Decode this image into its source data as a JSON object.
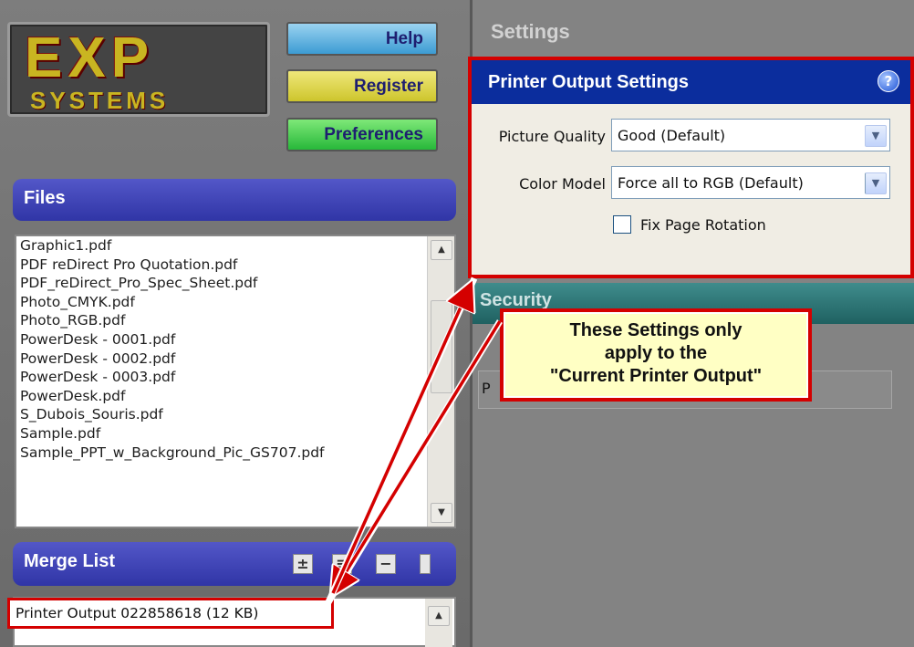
{
  "header": {
    "logo": {
      "line1": "EXP",
      "line2": "SYSTEMS"
    },
    "buttons": {
      "help": "Help",
      "register": "Register",
      "preferences": "Preferences"
    }
  },
  "files": {
    "title": "Files",
    "items": [
      "Graphic1.pdf",
      "PDF reDirect Pro Quotation.pdf",
      "PDF_reDirect_Pro_Spec_Sheet.pdf",
      "Photo_CMYK.pdf",
      "Photo_RGB.pdf",
      "PowerDesk - 0001.pdf",
      "PowerDesk - 0002.pdf",
      "PowerDesk - 0003.pdf",
      "PowerDesk.pdf",
      "S_Dubois_Souris.pdf",
      "Sample.pdf",
      "Sample_PPT_w_Background_Pic_GS707.pdf"
    ]
  },
  "merge_list": {
    "title": "Merge List",
    "items": [
      "Printer Output 022858618 (12 KB)"
    ]
  },
  "settings": {
    "title": "Settings",
    "printer_output": {
      "title": "Printer Output Settings",
      "picture_quality": {
        "label": "Picture Quality",
        "value": "Good (Default)"
      },
      "color_model": {
        "label": "Color Model",
        "value": "Force all  to RGB (Default)"
      },
      "fix_rotation": {
        "label": "Fix Page Rotation",
        "checked": false
      }
    },
    "security": {
      "title": "Security",
      "field_letter": "P"
    }
  },
  "callout": {
    "line1": "These Settings only",
    "line2": "apply to the",
    "line3": "\"Current Printer Output\""
  },
  "colors": {
    "annotation_red": "#d40000",
    "panel_header_blue": "#0b2d9d",
    "section_header": "#3b3fb6",
    "security_teal": "#2e7373"
  }
}
